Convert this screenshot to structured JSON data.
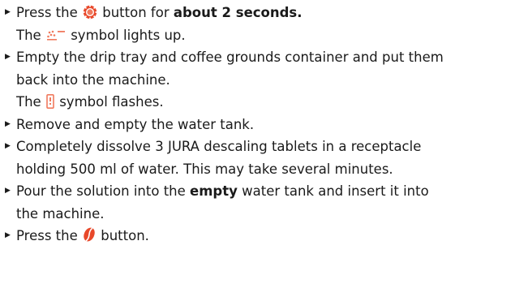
{
  "cut_line": {
    "pre": "Press the ",
    "accent": "(",
    "post": ") symbol lights up."
  },
  "colors": {
    "accent": "#e8482a",
    "text": "#1a1a1a"
  },
  "steps": [
    {
      "bullet": "▶",
      "parts": {
        "a": "Press the",
        "b": "button for",
        "c": "about 2 seconds.",
        "d": "The",
        "e": "symbol lights up."
      }
    },
    {
      "bullet": "▶",
      "parts": {
        "a": "Empty the drip tray and coffee grounds container and put them",
        "b": "back into the machine.",
        "c": "The",
        "d": "symbol flashes."
      }
    },
    {
      "bullet": "▶",
      "parts": {
        "a": "Remove and empty the water tank."
      }
    },
    {
      "bullet": "▶",
      "parts": {
        "a": "Completely dissolve 3 JURA descaling tablets in a receptacle",
        "b": "holding 500 ml of water. This may take several minutes."
      }
    },
    {
      "bullet": "▶",
      "parts": {
        "a": "Pour the solution into the",
        "b": "empty",
        "c": "water tank and insert it into",
        "d": "the machine."
      }
    },
    {
      "bullet": "▶",
      "parts": {
        "a": "Press the",
        "b": "button."
      }
    }
  ],
  "icons": {
    "maintenance_button": "gear-ring-icon",
    "descale_symbol": "descale-symbol-icon",
    "water_tank_symbol": "water-tank-icon",
    "coffee_bean_button": "coffee-bean-icon"
  }
}
